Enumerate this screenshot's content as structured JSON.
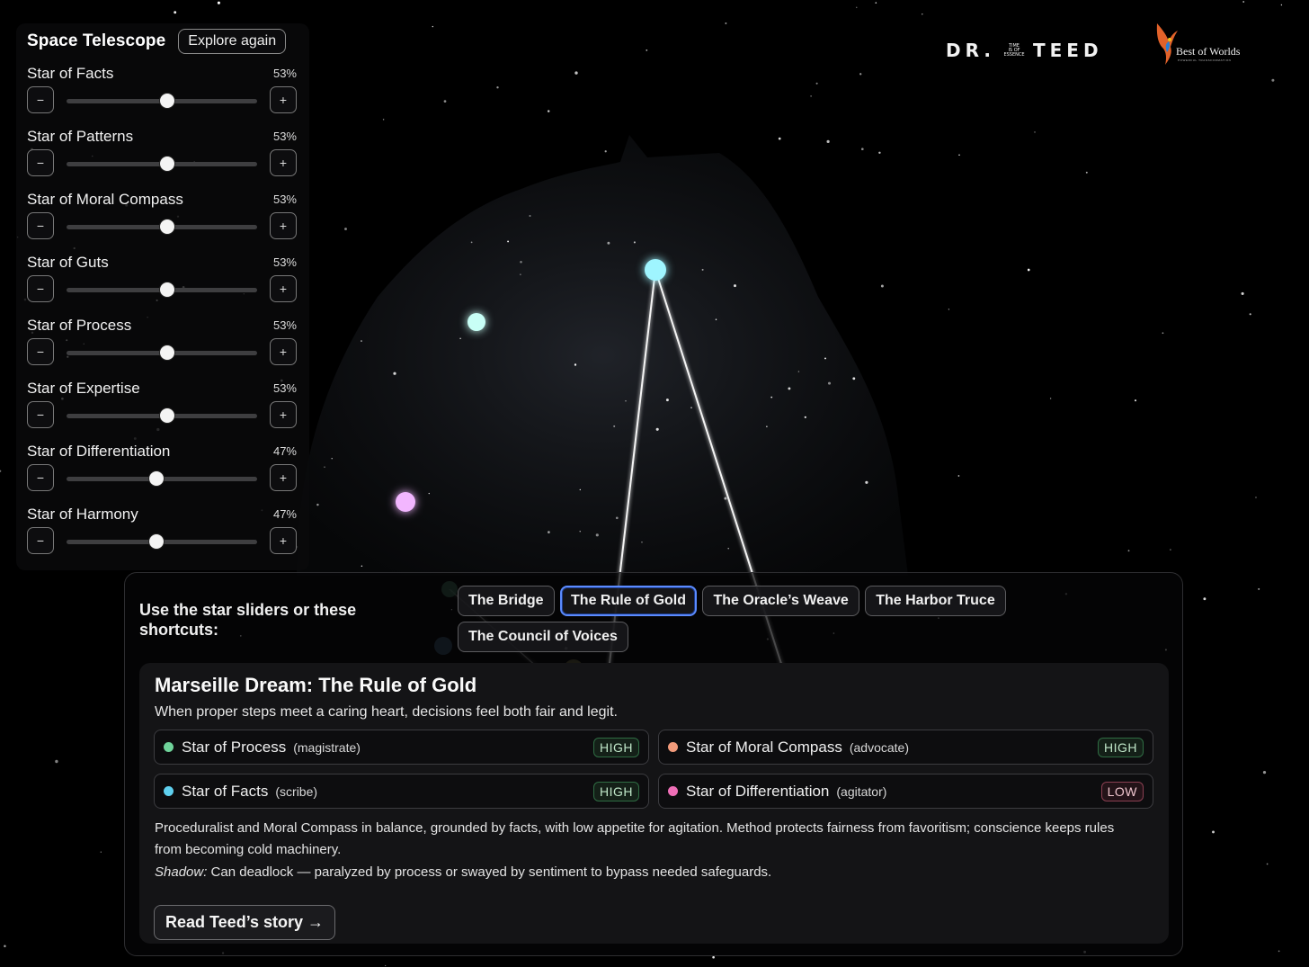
{
  "panel": {
    "title": "Space Telescope",
    "explore_label": "Explore again",
    "minus_label": "−",
    "plus_label": "+",
    "stars": [
      {
        "label": "Star of Facts",
        "percent": "53%",
        "value": 53
      },
      {
        "label": "Star of Patterns",
        "percent": "53%",
        "value": 53
      },
      {
        "label": "Star of Moral Compass",
        "percent": "53%",
        "value": 53
      },
      {
        "label": "Star of Guts",
        "percent": "53%",
        "value": 53
      },
      {
        "label": "Star of Process",
        "percent": "53%",
        "value": 53
      },
      {
        "label": "Star of Expertise",
        "percent": "53%",
        "value": 53
      },
      {
        "label": "Star of Differentiation",
        "percent": "47%",
        "value": 47
      },
      {
        "label": "Star of Harmony",
        "percent": "47%",
        "value": 47
      }
    ]
  },
  "logos": {
    "teed_left": "DR.",
    "teed_tagline": [
      "TIME",
      "IS OF",
      "ESSENCE"
    ],
    "teed_right": "TEED",
    "bow_name": "Best of Worlds",
    "bow_sub": "POWERFUL TRANSFORMATION"
  },
  "shortcuts": {
    "prompt": "Use the star sliders or these shortcuts:",
    "chips": [
      "The Bridge",
      "The Rule of Gold",
      "The Oracle’s Weave",
      "The Harbor Truce",
      "The Council of Voices"
    ],
    "active_chip": "The Rule of Gold"
  },
  "result": {
    "title": "Marseille Dream: The Rule of Gold",
    "subtitle": "When proper steps meet a caring heart, decisions feel both fair and legit.",
    "traits": [
      {
        "name": "Star of Process",
        "role": "(magistrate)",
        "level": "HIGH",
        "color": "#6fd39a"
      },
      {
        "name": "Star of Moral Compass",
        "role": "(advocate)",
        "level": "HIGH",
        "color": "#f29b7b"
      },
      {
        "name": "Star of Facts",
        "role": "(scribe)",
        "level": "HIGH",
        "color": "#5fd0ef"
      },
      {
        "name": "Star of Differentiation",
        "role": "(agitator)",
        "level": "LOW",
        "color": "#ef6fb7"
      }
    ],
    "description": "Proceduralist and Moral Compass in balance, grounded by facts, with low appetite for agitation. Method protects fairness from favoritism; conscience keeps rules from becoming cold machinery.",
    "shadow_label": "Shadow:",
    "shadow_text": " Can deadlock — paralyzed by process or swayed by sentiment to bypass needed safeguards.",
    "story_button": "Read Teed’s story →"
  },
  "colors": {
    "background": "#000000",
    "active_chip_border": "#5b8bff",
    "star_cyan": "#9ff5ff",
    "star_mint": "#c8fff6",
    "star_pink": "#f2b6ff"
  }
}
